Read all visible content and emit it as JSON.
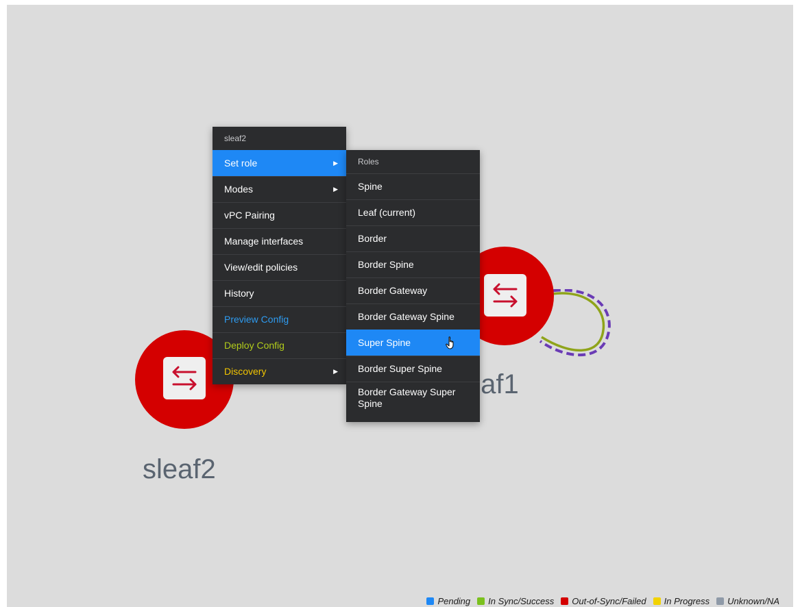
{
  "nodes": {
    "sleaf1": {
      "label": "sleaf1",
      "status_color": "#d40000"
    },
    "sleaf2": {
      "label": "sleaf2",
      "status_color": "#d40000"
    }
  },
  "context_menu": {
    "header": "sleaf2",
    "items": [
      {
        "label": "Set role",
        "has_submenu": true,
        "state": "active"
      },
      {
        "label": "Modes",
        "has_submenu": true
      },
      {
        "label": "vPC Pairing"
      },
      {
        "label": "Manage interfaces"
      },
      {
        "label": "View/edit policies"
      },
      {
        "label": "History"
      },
      {
        "label": "Preview Config",
        "color": "#2e9bf0"
      },
      {
        "label": "Deploy Config",
        "color": "#b2cc1b"
      },
      {
        "label": "Discovery",
        "has_submenu": true,
        "color": "#f2c500"
      }
    ]
  },
  "roles_submenu": {
    "header": "Roles",
    "items": [
      {
        "label": "Spine"
      },
      {
        "label": "Leaf (current)"
      },
      {
        "label": "Border"
      },
      {
        "label": "Border Spine"
      },
      {
        "label": "Border Gateway"
      },
      {
        "label": "Border Gateway Spine"
      },
      {
        "label": "Super Spine",
        "state": "hover"
      },
      {
        "label": "Border Super Spine"
      },
      {
        "label": "Border Gateway Super Spine"
      }
    ]
  },
  "legend": [
    {
      "label": "Pending",
      "color": "#1e88f5"
    },
    {
      "label": "In Sync/Success",
      "color": "#7bc11e"
    },
    {
      "label": "Out-of-Sync/Failed",
      "color": "#d40000"
    },
    {
      "label": "In Progress",
      "color": "#f2d200"
    },
    {
      "label": "Unknown/NA",
      "color": "#8f9aa8"
    }
  ],
  "icons": {
    "switch": "switch-arrows-icon",
    "submenu_arrow": "submenu-arrow-icon",
    "cursor": "hand-pointer-icon"
  }
}
